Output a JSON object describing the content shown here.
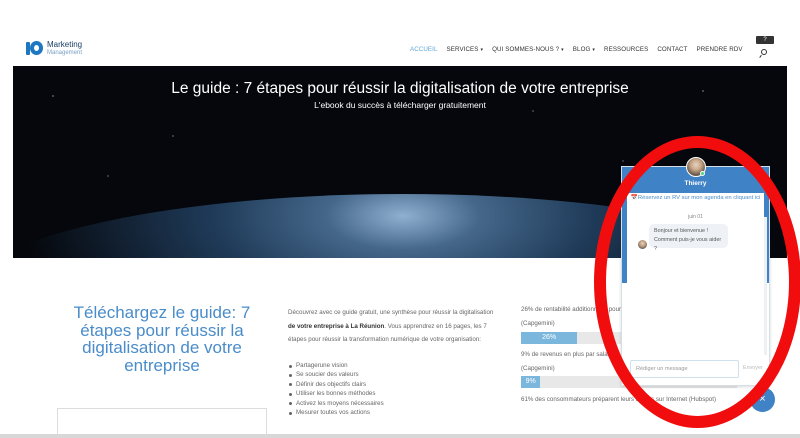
{
  "brand": {
    "line1": "Marketing",
    "line2": "Management"
  },
  "nav": {
    "items": [
      {
        "label": "ACCUEIL",
        "active": true,
        "caret": false
      },
      {
        "label": "SERVICES",
        "active": false,
        "caret": true
      },
      {
        "label": "QUI SOMMES-NOUS ?",
        "active": false,
        "caret": true
      },
      {
        "label": "BLOG",
        "active": false,
        "caret": true
      },
      {
        "label": "RESSOURCES",
        "active": false,
        "caret": false
      },
      {
        "label": "CONTACT",
        "active": false,
        "caret": false
      },
      {
        "label": "PRENDRE RDV",
        "active": false,
        "caret": false
      }
    ],
    "caret_glyph": "▾",
    "help_badge": "?"
  },
  "hero": {
    "title": "Le guide : 7 étapes pour réussir la digitalisation de votre entreprise",
    "subtitle": "L'ebook du succès à télécharger gratuitement"
  },
  "main": {
    "guide_title": "Téléchargez le guide: 7 étapes pour réussir la digitalisation de votre entreprise",
    "intro": {
      "part1": "Découvrez avec ce guide gratuit, une synthèse pour réussir la digitalisation ",
      "bold": "de votre entreprise à La Réunion",
      "part2": ". Vous apprendrez en 16 pages, les 7 étapes pour réussir la transformation numérique de votre organisation:"
    },
    "bullets": [
      "Partagerune vision",
      "Se soucier des valeurs",
      "Définir des objectifs clairs",
      "Utiliser les bonnes méthodes",
      "Activez les moyens nécessaires",
      "Mesurer toutes vos actions"
    ],
    "stats": [
      {
        "text": "26% de rentabilité additionnelle pour",
        "source": "(Capgemini)",
        "percent": 26,
        "bar_label": "26%"
      },
      {
        "text": "9% de revenus en plus par salarié",
        "source": "(Capgemini)",
        "percent": 9,
        "bar_label": "9%"
      },
      {
        "text": "61% des consommateurs préparent leurs achats sur Internet (Hubspot)"
      }
    ]
  },
  "chat": {
    "agent_name": "Thierry",
    "rdv_link": "📅Réservez un RV sur mon agenda en cliquant ici",
    "date": "juin 01",
    "bot_message": "Bonjour et bienvenue ! Comment puis-je vous aider ?",
    "input_placeholder": "Rédiger un message",
    "send_label": "Envoyer",
    "float_icon": "×"
  },
  "colors": {
    "accent": "#4a8cc9",
    "chat_header": "#3f82c6",
    "annotation": "#f10d0d",
    "stat_fill": "#7bb7dc"
  }
}
